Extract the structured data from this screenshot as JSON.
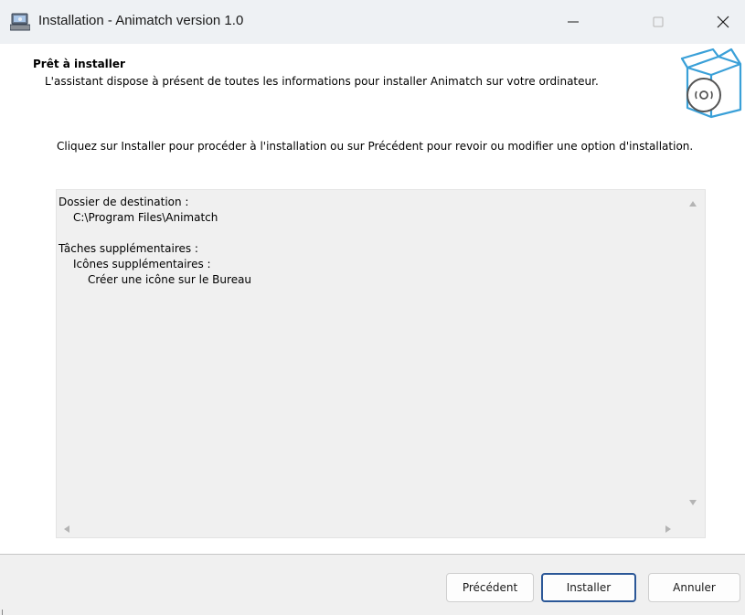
{
  "window": {
    "title": "Installation - Animatch version 1.0",
    "controls": {
      "minimize": "—",
      "maximize": "☐",
      "close": "✕"
    }
  },
  "header": {
    "title": "Prêt à installer",
    "subtitle": "L'assistant dispose à présent de toutes les informations pour installer Animatch sur votre ordinateur.",
    "icon": "software-box-cd-icon"
  },
  "body": {
    "instruction": "Cliquez sur Installer pour procéder à l'installation ou sur Précédent pour revoir ou modifier une option d'installation."
  },
  "summary": {
    "destination_label": "Dossier de destination :",
    "destination_path": "C:\\Program Files\\Animatch",
    "tasks_label": "Tâches supplémentaires :",
    "icons_label": "Icônes supplémentaires :",
    "desktop_icon": "Créer une icône sur le Bureau"
  },
  "buttons": {
    "back": "Précédent",
    "install": "Installer",
    "cancel": "Annuler"
  },
  "colors": {
    "titlebar_bg": "#eef1f4",
    "default_button_border": "#2b5797",
    "footer_bg": "#f0f0f0"
  }
}
